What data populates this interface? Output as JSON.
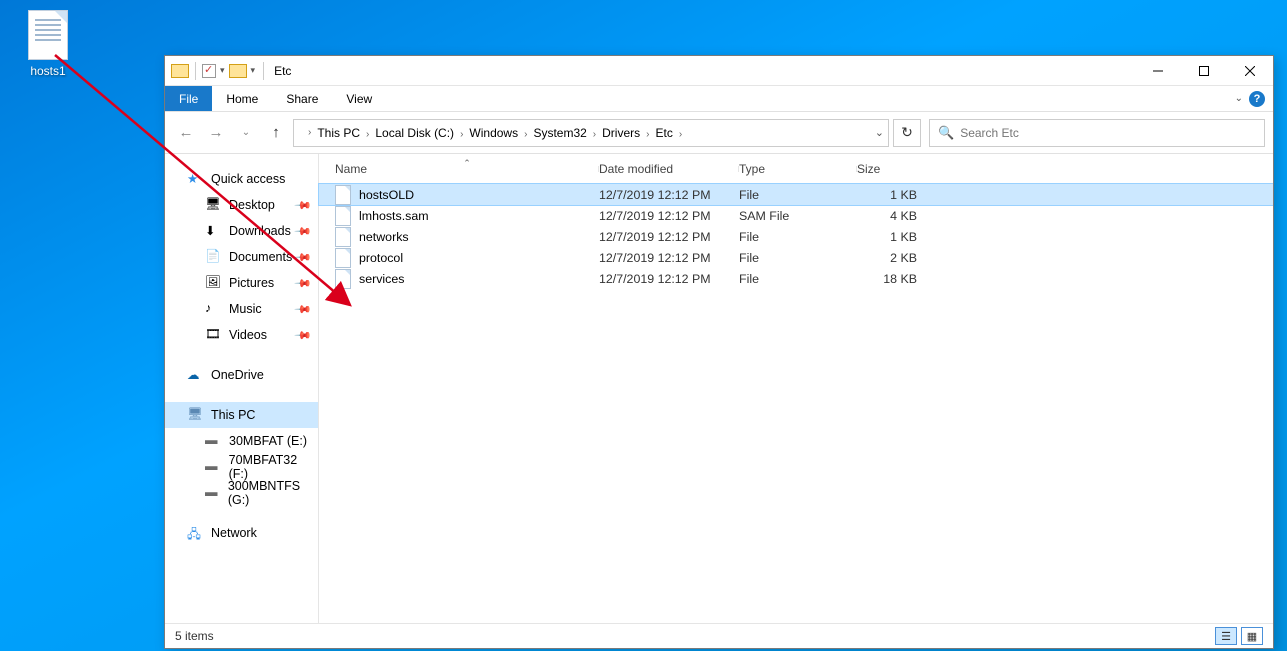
{
  "desktop": {
    "file_label": "hosts1"
  },
  "window": {
    "title": "Etc",
    "tabs": {
      "file": "File",
      "home": "Home",
      "share": "Share",
      "view": "View"
    }
  },
  "breadcrumbs": [
    "This PC",
    "Local Disk (C:)",
    "Windows",
    "System32",
    "Drivers",
    "Etc"
  ],
  "search_placeholder": "Search Etc",
  "columns": {
    "name": "Name",
    "modified": "Date modified",
    "type": "Type",
    "size": "Size"
  },
  "files": [
    {
      "name": "hostsOLD",
      "modified": "12/7/2019 12:12 PM",
      "type": "File",
      "size": "1 KB",
      "selected": true
    },
    {
      "name": "lmhosts.sam",
      "modified": "12/7/2019 12:12 PM",
      "type": "SAM File",
      "size": "4 KB",
      "selected": false
    },
    {
      "name": "networks",
      "modified": "12/7/2019 12:12 PM",
      "type": "File",
      "size": "1 KB",
      "selected": false
    },
    {
      "name": "protocol",
      "modified": "12/7/2019 12:12 PM",
      "type": "File",
      "size": "2 KB",
      "selected": false
    },
    {
      "name": "services",
      "modified": "12/7/2019 12:12 PM",
      "type": "File",
      "size": "18 KB",
      "selected": false
    }
  ],
  "nav": {
    "quick_access": "Quick access",
    "pinned": [
      "Desktop",
      "Downloads",
      "Documents",
      "Pictures",
      "Music",
      "Videos"
    ],
    "onedrive": "OneDrive",
    "this_pc": "This PC",
    "drives": [
      "30MBFAT (E:)",
      "70MBFAT32 (F:)",
      "300MBNTFS (G:)"
    ],
    "network": "Network"
  },
  "status": {
    "text": "5 items"
  }
}
